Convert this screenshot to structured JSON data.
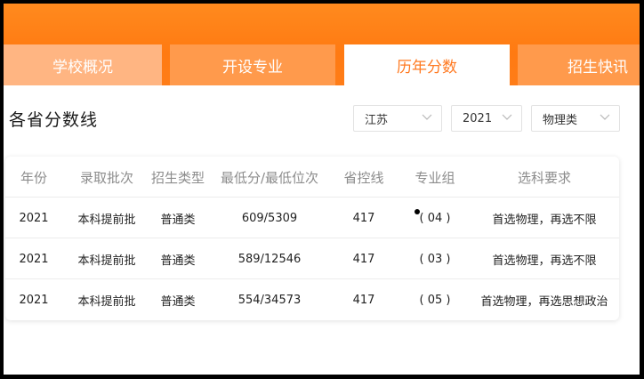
{
  "tabs": [
    {
      "label": "学校概况"
    },
    {
      "label": "开设专业"
    },
    {
      "label": "历年分数"
    },
    {
      "label": "招生快讯"
    }
  ],
  "active_tab": "历年分数",
  "colors": {
    "brand_orange": "#ff7a12",
    "active_tab_text": "#ff7a22"
  },
  "section_title": "各省分数线",
  "filters": {
    "province": "江苏",
    "year": "2021",
    "subject_type": "物理类"
  },
  "table": {
    "headers": [
      "年份",
      "录取批次",
      "招生类型",
      "最低分/最低位次",
      "省控线",
      "专业组",
      "选科要求"
    ],
    "rows": [
      [
        "2021",
        "本科提前批",
        "普通类",
        "609/5309",
        "417",
        "( 04 )",
        "首选物理，再选不限"
      ],
      [
        "2021",
        "本科提前批",
        "普通类",
        "589/12546",
        "417",
        "( 03 )",
        "首选物理，再选不限"
      ],
      [
        "2021",
        "本科提前批",
        "普通类",
        "554/34573",
        "417",
        "( 05 )",
        "首选物理，再选思想政治"
      ]
    ]
  }
}
